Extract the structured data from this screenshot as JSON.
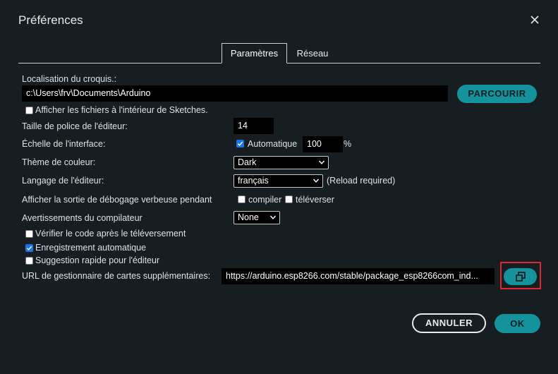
{
  "dialog": {
    "title": "Préférences"
  },
  "tabs": [
    {
      "label": "Paramètres"
    },
    {
      "label": "Réseau"
    }
  ],
  "settings": {
    "sketchbook_label": "Localisation du croquis.:",
    "sketchbook_path": "c:\\Users\\frv\\Documents\\Arduino",
    "browse_label": "PARCOURIR",
    "show_files_label": "Afficher les fichiers à l'intérieur de Sketches.",
    "font_size_label": "Taille de police de l'éditeur:",
    "font_size_value": "14",
    "scale_label": "Échelle de l'interface:",
    "scale_auto_label": "Automatique",
    "scale_value": "100",
    "scale_unit": "%",
    "theme_label": "Thème de couleur:",
    "theme_value": "Dark",
    "language_label": "Langage de l'éditeur:",
    "language_value": "français",
    "reload_note": "(Reload required)",
    "verbose_label": "Afficher la sortie de débogage verbeuse pendant",
    "verbose_compile_label": "compiler",
    "verbose_upload_label": "téléverser",
    "warnings_label": "Avertissements du compilateur",
    "warnings_value": "None",
    "verify_label": "Vérifier le code après le téléversement",
    "autosave_label": "Enregistrement automatique",
    "quick_suggest_label": "Suggestion rapide pour l'éditeur",
    "boards_url_label": "URL de gestionnaire de cartes supplémentaires:",
    "boards_url_value": "https://arduino.esp8266.com/stable/package_esp8266com_ind..."
  },
  "checkbox_states": {
    "show_files": false,
    "scale_auto": true,
    "verbose_compile": false,
    "verbose_upload": false,
    "verify": false,
    "autosave": true,
    "quick_suggest": false
  },
  "footer": {
    "cancel_label": "ANNULER",
    "ok_label": "OK"
  },
  "colors": {
    "background": "#171e21",
    "accent": "#15939d",
    "highlight": "#e0262d",
    "checkbox_on": "#1a73e8"
  },
  "icons": {
    "close": "close-icon",
    "open_external": "open-window-icon",
    "dropdown": "chevron-down-icon",
    "check": "checkmark-icon"
  }
}
